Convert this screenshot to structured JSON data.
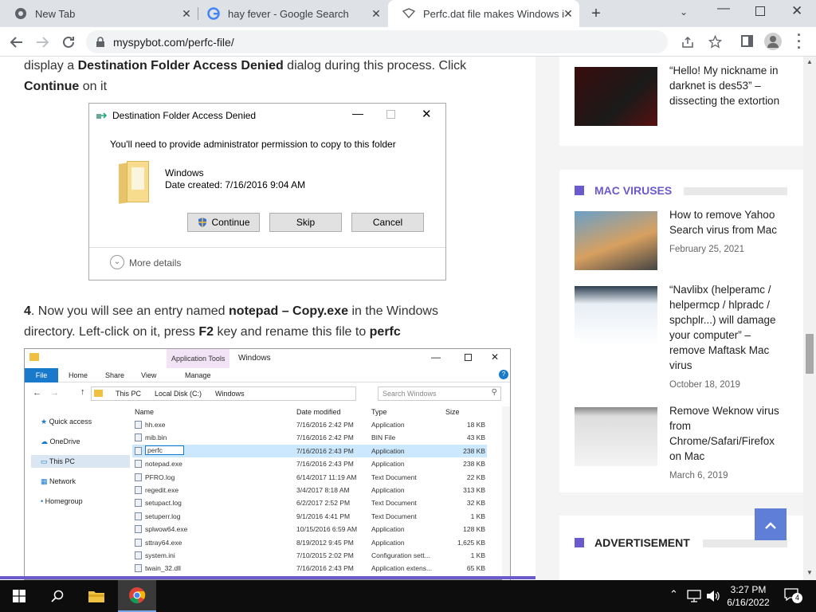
{
  "browser": {
    "tabs": [
      {
        "label": "New Tab"
      },
      {
        "label": "hay fever - Google Search"
      },
      {
        "label": "Perfc.dat file makes Windows im"
      }
    ],
    "url": "myspybot.com/perfc-file/"
  },
  "article": {
    "para1": {
      "pre": "display a ",
      "bold": "Destination Folder Access Denied",
      "mid": " dialog during this process. Click",
      "bold2": "Continue",
      "post": " on it"
    },
    "dialog": {
      "title": "Destination Folder Access Denied",
      "message": "You'll need to provide administrator permission to copy to this folder",
      "item_name": "Windows",
      "item_date": "Date created: 7/16/2016 9:04 AM",
      "buttons": [
        "Continue",
        "Skip",
        "Cancel"
      ],
      "more_details": "More details"
    },
    "step4": {
      "num": "4",
      "t1": ". Now you will see an entry named ",
      "b1": "notepad – Copy.exe",
      "t2": " in the Windows",
      "t3": "directory. Left-click on it, press ",
      "b2": "F2",
      "t4": " key and rename this file to ",
      "b3": "perfc"
    },
    "explorer": {
      "title": "Windows",
      "context_tab": "Application Tools",
      "ribbon_tabs": [
        "File",
        "Home",
        "Share",
        "View",
        "Manage"
      ],
      "path": [
        "This PC",
        "Local Disk (C:)",
        "Windows"
      ],
      "search_placeholder": "Search Windows",
      "nav": [
        "Quick access",
        "OneDrive",
        "This PC",
        "Network",
        "Homegroup"
      ],
      "columns": [
        "Name",
        "Date modified",
        "Type",
        "Size"
      ],
      "rows": [
        {
          "name": "hh.exe",
          "date": "7/16/2016 2:42 PM",
          "type": "Application",
          "size": "18 KB"
        },
        {
          "name": "mib.bin",
          "date": "7/16/2016 2:42 PM",
          "type": "BIN File",
          "size": "43 KB"
        },
        {
          "name": "perfc",
          "date": "7/16/2016 2:43 PM",
          "type": "Application",
          "size": "238 KB"
        },
        {
          "name": "notepad.exe",
          "date": "7/16/2016 2:43 PM",
          "type": "Application",
          "size": "238 KB"
        },
        {
          "name": "PFRO.log",
          "date": "6/14/2017 11:19 AM",
          "type": "Text Document",
          "size": "22 KB"
        },
        {
          "name": "regedit.exe",
          "date": "3/4/2017 8:18 AM",
          "type": "Application",
          "size": "313 KB"
        },
        {
          "name": "setupact.log",
          "date": "6/2/2017 2:52 PM",
          "type": "Text Document",
          "size": "32 KB"
        },
        {
          "name": "setuperr.log",
          "date": "9/1/2016 4:41 PM",
          "type": "Text Document",
          "size": "1 KB"
        },
        {
          "name": "splwow64.exe",
          "date": "10/15/2016 6:59 AM",
          "type": "Application",
          "size": "128 KB"
        },
        {
          "name": "sttray64.exe",
          "date": "8/19/2012 9:45 PM",
          "type": "Application",
          "size": "1,625 KB"
        },
        {
          "name": "system.ini",
          "date": "7/10/2015 2:02 PM",
          "type": "Configuration sett...",
          "size": "1 KB"
        },
        {
          "name": "twain_32.dll",
          "date": "7/16/2016 2:43 PM",
          "type": "Application extens...",
          "size": "65 KB"
        }
      ]
    }
  },
  "sidebar": {
    "top_post": {
      "title": "“Hello! My nickname in darknet is des53” – dissecting the extortion"
    },
    "mac_section": "MAC VIRUSES",
    "posts": [
      {
        "title": "How to remove Yahoo Search virus from Mac",
        "date": "February 25, 2021"
      },
      {
        "title": "“Navlibx (helperamc / helpermcp / hlpradc / spchplr...) will damage your computer” – remove Maftask Mac virus",
        "date": "October 18, 2019"
      },
      {
        "title": "Remove Weknow virus from Chrome/Safari/Firefox on Mac",
        "date": "March 6, 2019"
      }
    ],
    "ad_section": "ADVERTISEMENT",
    "accent_color": "#6a5acd"
  },
  "taskbar": {
    "time": "3:27 PM",
    "date": "6/16/2022",
    "notif_count": "4"
  }
}
